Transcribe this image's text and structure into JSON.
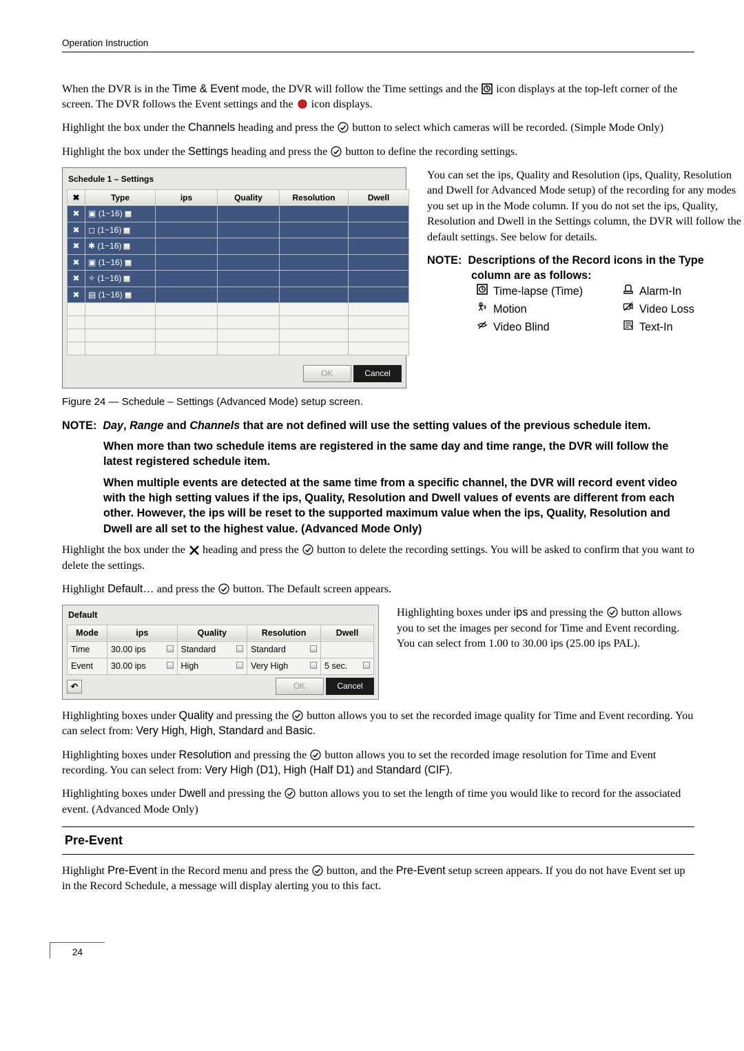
{
  "running_header": "Operation Instruction",
  "p1_pre": "When the DVR is in the ",
  "p1_mode": "Time & Event",
  "p1_mid": " mode, the DVR will follow the Time settings and the ",
  "p1_mid2": " icon displays at the top-left corner of the screen.  The DVR follows the Event settings and the ",
  "p1_end": " icon displays.",
  "p2_pre": "Highlight the box under the ",
  "p2_channels": "Channels",
  "p2_mid": " heading and press the ",
  "p2_end": " button to select which cameras will be recorded. (Simple Mode Only)",
  "p3_pre": "Highlight the box under the ",
  "p3_settings": "Settings",
  "p3_mid": " heading and press the ",
  "p3_end": " button to define the recording settings.",
  "schedule": {
    "title": "Schedule 1 – Settings",
    "headers": {
      "x": "✖",
      "type": "Type",
      "ips": "ips",
      "quality": "Quality",
      "resolution": "Resolution",
      "dwell": "Dwell"
    },
    "rows": [
      {
        "icon": "▣",
        "label": "(1~16)"
      },
      {
        "icon": "◻",
        "label": "(1~16)"
      },
      {
        "icon": "✱",
        "label": "(1~16)"
      },
      {
        "icon": "▣",
        "label": "(1~16)"
      },
      {
        "icon": "✧",
        "label": "(1~16)"
      },
      {
        "icon": "▤",
        "label": "(1~16)"
      }
    ],
    "ok": "OK",
    "cancel": "Cancel"
  },
  "side_text": "You can set the ips, Quality and Resolution (ips, Quality, Resolution and Dwell for Advanced Mode setup) of the recording for any modes you set up in the Mode column.  If you do not set the ips, Quality, Resolution and Dwell in the Settings column, the DVR will follow the default settings.  See below for details.",
  "note_icons_label": "NOTE:",
  "note_icons_text": "Descriptions of the Record icons in the Type column are as follows:",
  "legend": {
    "time": "Time-lapse (Time)",
    "alarm": "Alarm-In",
    "motion": "Motion",
    "video_loss": "Video Loss",
    "video_blind": "Video Blind",
    "text_in": "Text-In"
  },
  "caption": "Figure 24 — Schedule – Settings (Advanced Mode) setup screen.",
  "note2_lead": "NOTE:",
  "note2_line1a": "Day",
  "note2_line1b": ", ",
  "note2_line1c": "Range",
  "note2_line1d": " and ",
  "note2_line1e": "Channels",
  "note2_line1f": " that are not defined will use the setting values of the previous schedule item.",
  "note2_line2": "When more than two schedule items are registered in the same day and time range, the DVR will follow the latest registered schedule item.",
  "note2_line3": "When multiple events are detected at the same time from a specific channel, the DVR will record event video with the high setting values if the ips, Quality, Resolution and Dwell values of events are different from each other.  However, the ips will be reset to the supported maximum value when the ips, Quality, Resolution and Dwell are all set to the highest value. (Advanced Mode Only)",
  "p4_pre": "Highlight the box under the ",
  "p4_mid": " heading and press the ",
  "p4_end": " button to delete the recording settings.  You will be asked to confirm that you want to delete the settings.",
  "p5_pre": "Highlight ",
  "p5_def": "Default…",
  "p5_mid": "  and press the ",
  "p5_end": " button.  The Default screen appears.",
  "default_box": {
    "title": "Default",
    "headers": {
      "mode": "Mode",
      "ips": "ips",
      "quality": "Quality",
      "resolution": "Resolution",
      "dwell": "Dwell"
    },
    "rows": [
      {
        "mode": "Time",
        "ips": "30.00 ips",
        "quality": "Standard",
        "resolution": "Standard",
        "dwell": ""
      },
      {
        "mode": "Event",
        "ips": "30.00 ips",
        "quality": "High",
        "resolution": "Very High",
        "dwell": "5 sec."
      }
    ],
    "undo": "↶",
    "ok": "OK",
    "cancel": "Cancel"
  },
  "side2_pre": "Highlighting boxes under ",
  "side2_ips": "ips",
  "side2_mid": " and pressing the ",
  "side2_end": " button allows you to set the images per second for Time and Event recording.  You can select from 1.00 to 30.00 ips (25.00 ips PAL).",
  "p6_pre": "Highlighting boxes under ",
  "p6_q": "Quality",
  "p6_mid": " and pressing the ",
  "p6_mid2": " button allows you to set the recorded image quality for Time and Event recording.  You can select from:  ",
  "p6_vh": "Very High",
  "p6_h": "High",
  "p6_s": "Standard",
  "p6_b": "Basic",
  "p7_pre": "Highlighting boxes under ",
  "p7_r": "Resolution",
  "p7_mid": " and pressing the ",
  "p7_mid2": " button allows you to set the recorded image resolution for Time and Event recording.  You can select from:  ",
  "p7_vh": "Very High (D1)",
  "p7_h": "High (Half D1)",
  "p7_s": "Standard (CIF)",
  "p8_pre": "Highlighting boxes under ",
  "p8_d": "Dwell",
  "p8_mid": " and pressing the ",
  "p8_end": " button allows you to set the length of time you would like to record for the associated event. (Advanced Mode Only)",
  "section_head": "Pre-Event",
  "p9_pre": "Highlight ",
  "p9_pe": "Pre-Event",
  "p9_mid": " in the Record menu and press the ",
  "p9_mid2": " button, and the ",
  "p9_pe2": "Pre-Event",
  "p9_end": " setup screen appears.  If you do not have Event set up in the Record Schedule, a message will display alerting you to this fact.",
  "page_no": "24"
}
